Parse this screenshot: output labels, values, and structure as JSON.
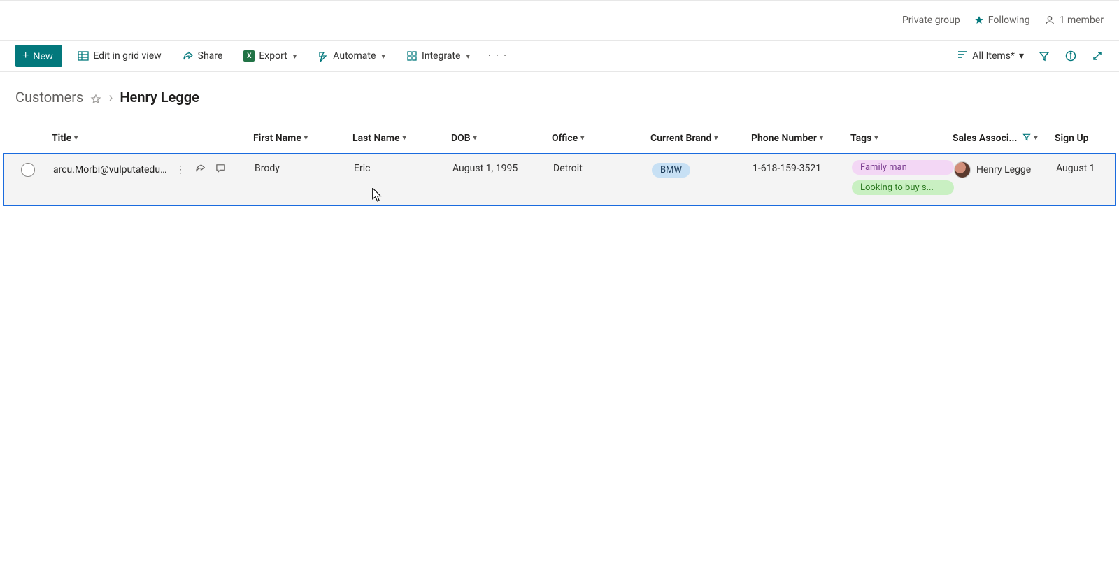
{
  "meta": {
    "privacy": "Private group",
    "following": "Following",
    "members": "1 member"
  },
  "toolbar": {
    "new_label": "New",
    "edit_grid": "Edit in grid view",
    "share": "Share",
    "export": "Export",
    "automate": "Automate",
    "integrate": "Integrate",
    "view_name": "All Items*"
  },
  "breadcrumb": {
    "root": "Customers",
    "current": "Henry Legge"
  },
  "columns": {
    "title": "Title",
    "first_name": "First Name",
    "last_name": "Last Name",
    "dob": "DOB",
    "office": "Office",
    "current_brand": "Current Brand",
    "phone": "Phone Number",
    "tags": "Tags",
    "sales_assoc": "Sales Associ...",
    "sign_up": "Sign Up"
  },
  "row": {
    "title": "arcu.Morbi@vulputatedui...",
    "first_name": "Brody",
    "last_name": "Eric",
    "dob": "August 1, 1995",
    "office": "Detroit",
    "brand": "BMW",
    "phone": "1-618-159-3521",
    "tag1": "Family man",
    "tag2": "Looking to buy s...",
    "sales_assoc": "Henry Legge",
    "sign_up": "August 1"
  }
}
